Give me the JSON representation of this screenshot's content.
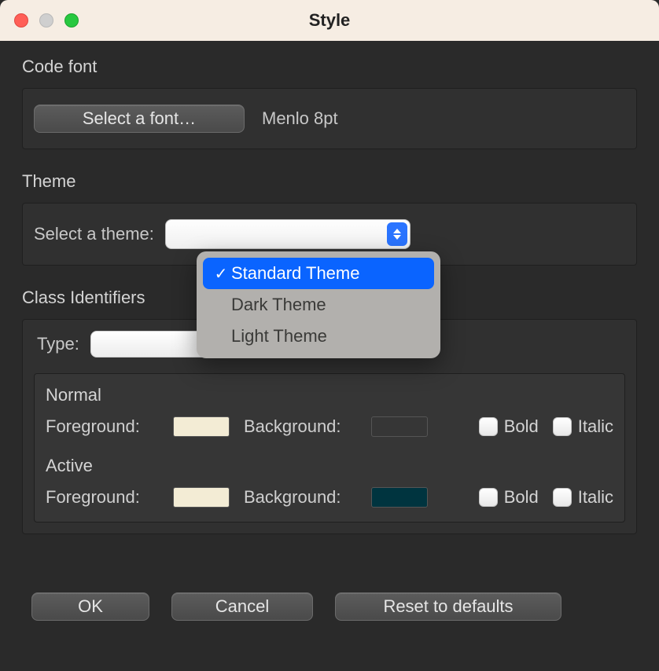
{
  "window": {
    "title": "Style"
  },
  "codeFont": {
    "section_label": "Code font",
    "button_label": "Select a font…",
    "current": "Menlo 8pt"
  },
  "theme": {
    "section_label": "Theme",
    "row_label": "Select a theme:",
    "selected_index": 0,
    "options": [
      {
        "label": "Standard Theme"
      },
      {
        "label": "Dark Theme"
      },
      {
        "label": "Light Theme"
      }
    ]
  },
  "classIdentifiers": {
    "section_label": "Class Identifiers",
    "type_label": "Type:",
    "type_value": "",
    "normal": {
      "title": "Normal",
      "fg_label": "Foreground:",
      "bg_label": "Background:",
      "fg_color": "#f3ecd5",
      "bg_color": "transparent",
      "bold_label": "Bold",
      "italic_label": "Italic",
      "bold": false,
      "italic": false
    },
    "active": {
      "title": "Active",
      "fg_label": "Foreground:",
      "bg_label": "Background:",
      "fg_color": "#f3ecd5",
      "bg_color": "#00343f",
      "bold_label": "Bold",
      "italic_label": "Italic",
      "bold": false,
      "italic": false
    }
  },
  "buttons": {
    "ok": "OK",
    "cancel": "Cancel",
    "reset": "Reset to defaults"
  }
}
